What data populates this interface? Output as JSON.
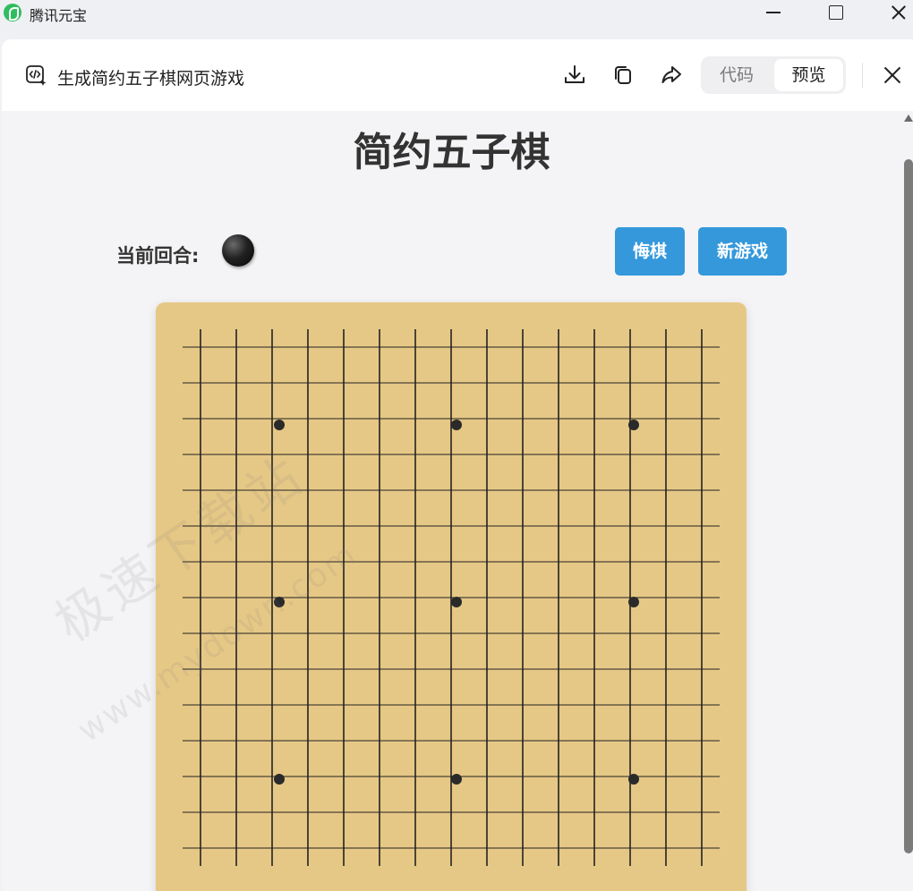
{
  "window": {
    "app_title": "腾讯元宝"
  },
  "header": {
    "title": "生成简约五子棋网页游戏",
    "icons": [
      "code-icon",
      "download-icon",
      "copy-icon",
      "share-icon",
      "close-icon"
    ],
    "toggle": {
      "code_label": "代码",
      "preview_label": "预览",
      "selected": "预览"
    }
  },
  "game": {
    "title": "简约五子棋",
    "turn_label": "当前回合:",
    "current_turn": "black",
    "undo_label": "悔棋",
    "new_game_label": "新游戏",
    "board": {
      "size": 15,
      "star_points": [
        [
          3,
          3
        ],
        [
          3,
          7
        ],
        [
          3,
          11
        ],
        [
          7,
          3
        ],
        [
          7,
          7
        ],
        [
          7,
          11
        ],
        [
          11,
          3
        ],
        [
          11,
          7
        ],
        [
          11,
          11
        ]
      ],
      "stones": []
    }
  },
  "watermark": {
    "text": "极速下载站",
    "url": "www.mydown.com"
  },
  "colors": {
    "button": "#3498db",
    "board": "#e6c886",
    "grid": "#222222",
    "background": "#f4f4f6"
  }
}
